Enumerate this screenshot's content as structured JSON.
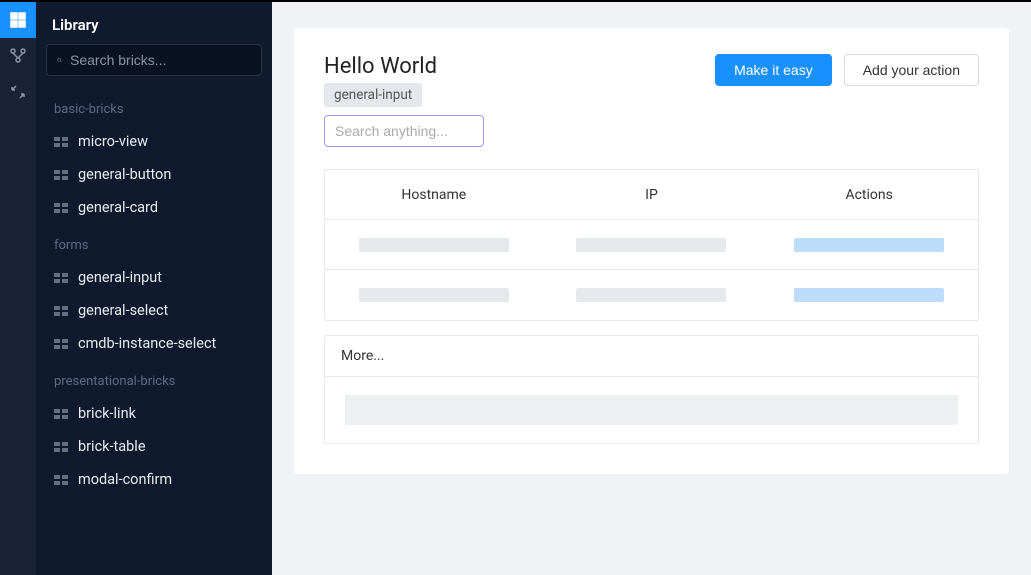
{
  "sidebar": {
    "title": "Library",
    "search_placeholder": "Search bricks...",
    "groups": [
      {
        "title": "basic-bricks",
        "items": [
          "micro-view",
          "general-button",
          "general-card"
        ]
      },
      {
        "title": "forms",
        "items": [
          "general-input",
          "general-select",
          "cmdb-instance-select"
        ]
      },
      {
        "title": "presentational-bricks",
        "items": [
          "brick-link",
          "brick-table",
          "modal-confirm"
        ]
      }
    ]
  },
  "page": {
    "title": "Hello World",
    "primary_button": "Make it easy",
    "secondary_button": "Add your action",
    "tag": "general-input",
    "search_placeholder": "Search anything..."
  },
  "table": {
    "columns": [
      "Hostname",
      "IP",
      "Actions"
    ]
  },
  "more": {
    "title": "More..."
  }
}
